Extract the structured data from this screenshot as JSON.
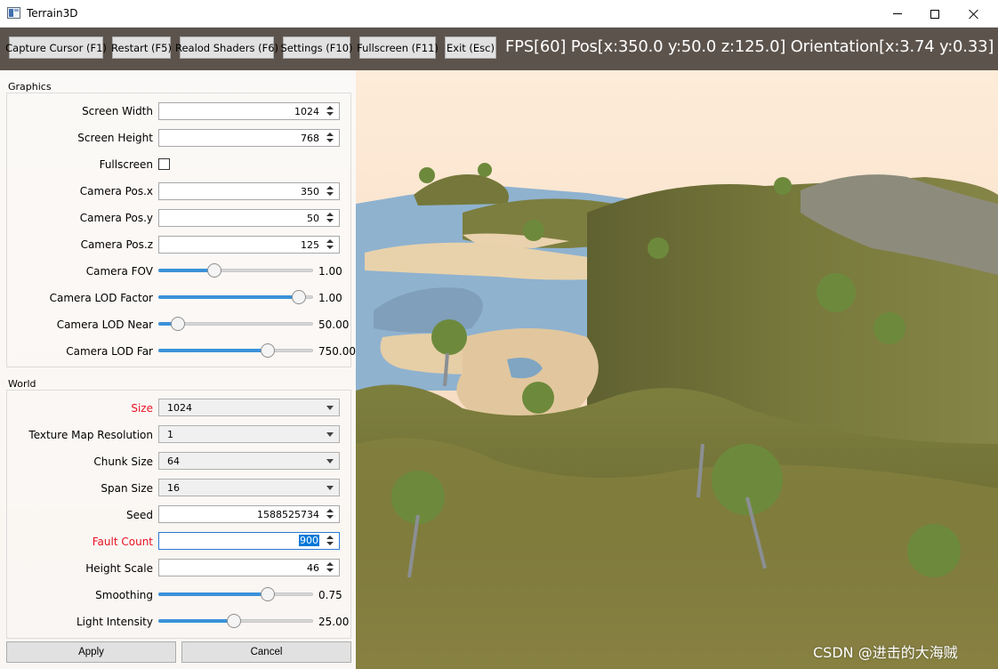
{
  "window": {
    "title": "Terrain3D"
  },
  "toolbar": {
    "buttons": [
      "Capture Cursor (F1)",
      "Restart (F5)",
      "Realod Shaders (F6)",
      "Settings (F10)",
      "Fullscreen (F11)",
      "Exit (Esc)"
    ],
    "status": "FPS[60]  Pos[x:350.0 y:50.0 z:125.0]  Orientation[x:3.74 y:0.33]"
  },
  "graphics": {
    "group_title": "Graphics",
    "screen_width": {
      "label": "Screen Width",
      "value": "1024"
    },
    "screen_height": {
      "label": "Screen Height",
      "value": "768"
    },
    "fullscreen": {
      "label": "Fullscreen",
      "checked": false
    },
    "camera_pos_x": {
      "label": "Camera Pos.x",
      "value": "350"
    },
    "camera_pos_y": {
      "label": "Camera Pos.y",
      "value": "50"
    },
    "camera_pos_z": {
      "label": "Camera Pos.z",
      "value": "125"
    },
    "camera_fov": {
      "label": "Camera FOV",
      "value": "1.00",
      "fraction": 0.35
    },
    "camera_lod_factor": {
      "label": "Camera LOD Factor",
      "value": "1.00",
      "fraction": 0.95
    },
    "camera_lod_near": {
      "label": "Camera LOD Near",
      "value": "50.00",
      "fraction": 0.09
    },
    "camera_lod_far": {
      "label": "Camera LOD Far",
      "value": "750.00",
      "fraction": 0.73
    }
  },
  "world": {
    "group_title": "World",
    "size": {
      "label": "Size",
      "value": "1024"
    },
    "texture_map_resolution": {
      "label": "Texture Map Resolution",
      "value": "1"
    },
    "chunk_size": {
      "label": "Chunk Size",
      "value": "64"
    },
    "span_size": {
      "label": "Span Size",
      "value": "16"
    },
    "seed": {
      "label": "Seed",
      "value": "1588525734"
    },
    "fault_count": {
      "label": "Fault Count",
      "value": "900"
    },
    "height_scale": {
      "label": "Height Scale",
      "value": "46"
    },
    "smoothing": {
      "label": "Smoothing",
      "value": "0.75",
      "fraction": 0.73
    },
    "light_intensity": {
      "label": "Light Intensity",
      "value": "25.00",
      "fraction": 0.49
    }
  },
  "footer": {
    "apply": "Apply",
    "cancel": "Cancel"
  },
  "watermark": "CSDN @进击的大海贼",
  "colors": {
    "toolbar_bg": "#5c534c",
    "sky": "#fbe3cc",
    "water": "#7fa9c9",
    "sand": "#e8d3ae",
    "grass": "#7b7d3c",
    "slider_fill": "#3c92d9",
    "warning_label": "#e81123"
  }
}
